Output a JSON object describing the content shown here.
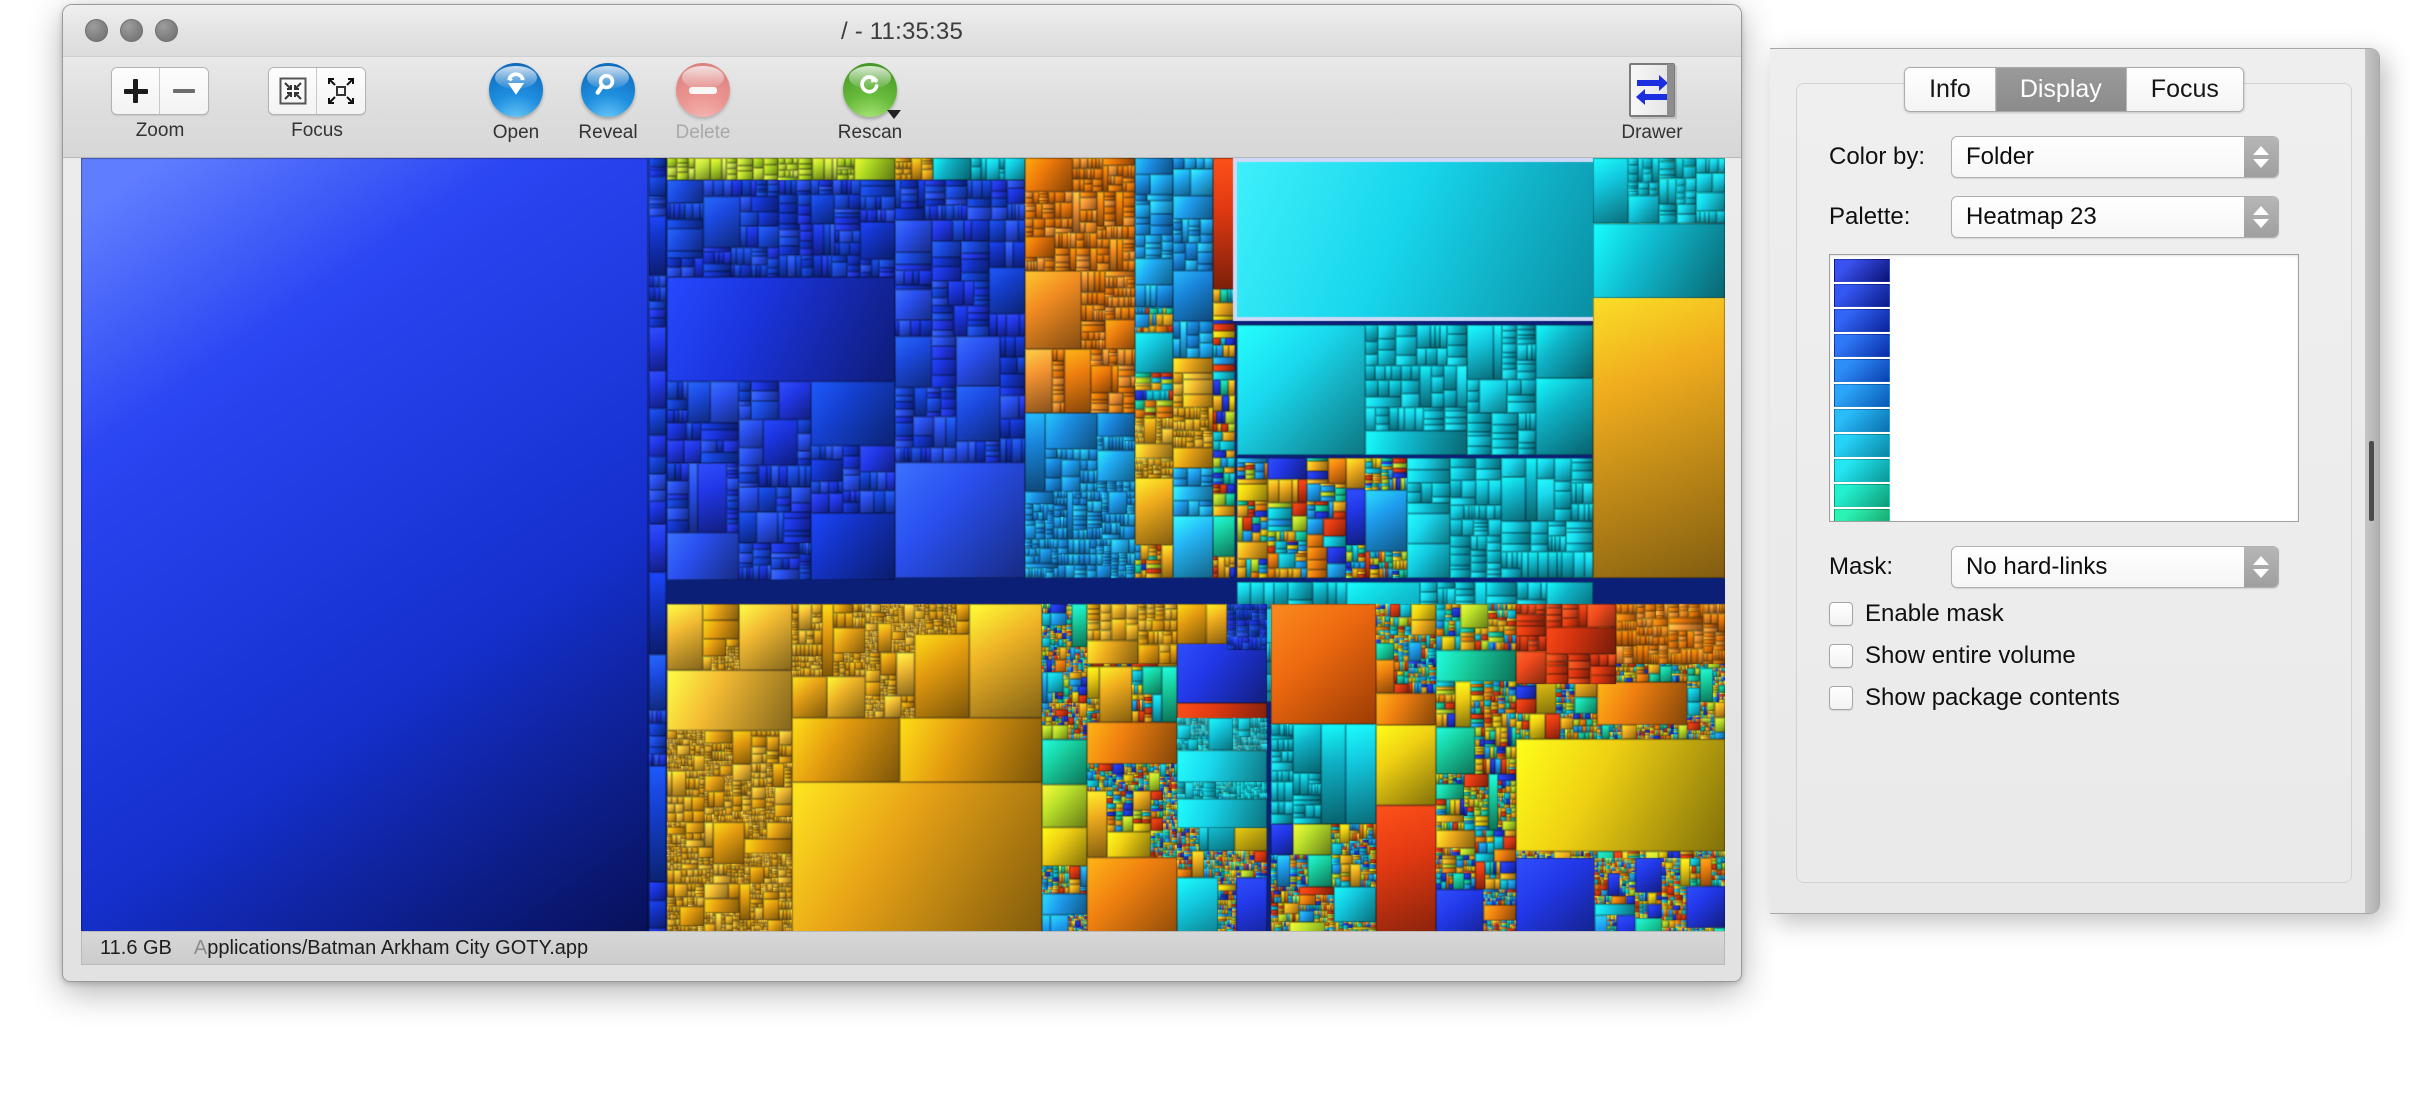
{
  "window": {
    "title": "/ - 11:35:35",
    "traffic_lights": [
      "close",
      "minimize",
      "zoom"
    ]
  },
  "toolbar": {
    "zoom_label": "Zoom",
    "zoom_in_icon": "plus-icon",
    "zoom_out_icon": "minus-icon",
    "focus_label": "Focus",
    "focus_in_icon": "contract-arrows-icon",
    "focus_out_icon": "expand-arrows-icon",
    "open_label": "Open",
    "open_icon": "download-arrow-icon",
    "reveal_label": "Reveal",
    "reveal_icon": "magnifier-icon",
    "delete_label": "Delete",
    "delete_icon": "minus-circle-icon",
    "delete_disabled": true,
    "rescan_label": "Rescan",
    "rescan_icon": "refresh-icon",
    "drawer_label": "Drawer",
    "drawer_icon": "drawer-arrows-icon"
  },
  "status": {
    "size": "11.6 GB",
    "path_prefix": "A",
    "path": "pplications/Batman Arkham City GOTY.app"
  },
  "drawer": {
    "tabs": [
      {
        "label": "Info",
        "active": false
      },
      {
        "label": "Display",
        "active": true
      },
      {
        "label": "Focus",
        "active": false
      }
    ],
    "color_by": {
      "label": "Color by:",
      "value": "Folder"
    },
    "palette": {
      "label": "Palette:",
      "value": "Heatmap 23"
    },
    "palette_swatches": [
      {
        "from": "#3a52f0",
        "to": "#0a1174"
      },
      {
        "from": "#3558f4",
        "to": "#0b1a86"
      },
      {
        "from": "#3166f6",
        "to": "#0b2299"
      },
      {
        "from": "#2f78f7",
        "to": "#0a2da6"
      },
      {
        "from": "#2e8ef8",
        "to": "#0a3fb0"
      },
      {
        "from": "#2ba5f9",
        "to": "#0a58b4"
      },
      {
        "from": "#29bcf9",
        "to": "#0a6fad"
      },
      {
        "from": "#26d2f8",
        "to": "#0a85a4"
      },
      {
        "from": "#24e6f2",
        "to": "#0a9697"
      },
      {
        "from": "#22f0cf",
        "to": "#0f9a78"
      },
      {
        "from": "#2af3b4",
        "to": "#169a62"
      }
    ],
    "mask": {
      "label": "Mask:",
      "value": "No hard-links"
    },
    "checkboxes": [
      {
        "label": "Enable mask",
        "checked": false
      },
      {
        "label": "Show entire volume",
        "checked": false
      },
      {
        "label": "Show package contents",
        "checked": false
      }
    ],
    "grip_icon": "drawer-grip-handle"
  },
  "treemap": {
    "background": "#0b1f77",
    "selected_cell_border": "#cdd9f7",
    "description": "Disk usage treemap of the root volume, colored by folder using the Heatmap 23 palette"
  }
}
